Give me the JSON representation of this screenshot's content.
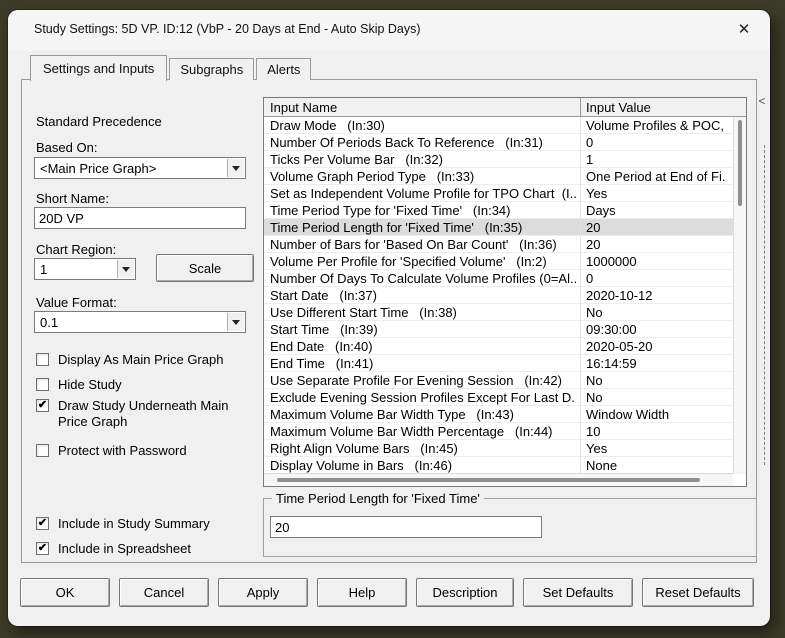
{
  "window": {
    "title": "Study Settings: 5D VP. ID:12 (VbP - 20 Days at End - Auto Skip Days)",
    "close_icon": "✕"
  },
  "tabs": [
    {
      "label": "Settings and Inputs",
      "active": true
    },
    {
      "label": "Subgraphs",
      "active": false
    },
    {
      "label": "Alerts",
      "active": false
    }
  ],
  "left_panel": {
    "precedence_label": "Standard Precedence",
    "based_on": {
      "label": "Based On:",
      "value": "<Main Price Graph>"
    },
    "short_name": {
      "label": "Short Name:",
      "value": "20D VP"
    },
    "chart_region": {
      "label": "Chart Region:",
      "value": "1"
    },
    "scale_button": "Scale",
    "value_format": {
      "label": "Value Format:",
      "value": "0.1"
    },
    "checkboxes": [
      {
        "label": "Display As Main Price Graph",
        "checked": false
      },
      {
        "label": "Hide Study",
        "checked": false
      },
      {
        "label": "Draw Study Underneath Main Price Graph",
        "checked": true
      },
      {
        "label": "Protect with Password",
        "checked": false
      }
    ],
    "bottom_checkboxes": [
      {
        "label": "Include in Study Summary",
        "checked": true
      },
      {
        "label": "Include in Spreadsheet",
        "checked": true
      }
    ]
  },
  "inputs_table": {
    "columns": [
      "Input Name",
      "Input Value"
    ],
    "selected_index": 6,
    "rows": [
      {
        "name": "Draw Mode   (In:30)",
        "value": "Volume Profiles & POC,"
      },
      {
        "name": "Number Of Periods Back To Reference   (In:31)",
        "value": "0"
      },
      {
        "name": "Ticks Per Volume Bar   (In:32)",
        "value": "1"
      },
      {
        "name": "Volume Graph Period Type   (In:33)",
        "value": "One Period at End of Fi."
      },
      {
        "name": "Set as Independent Volume Profile for TPO Chart  (I...",
        "value": "Yes"
      },
      {
        "name": "Time Period Type for 'Fixed Time'   (In:34)",
        "value": "Days"
      },
      {
        "name": "Time Period Length for 'Fixed Time'   (In:35)",
        "value": "20"
      },
      {
        "name": "Number of Bars for 'Based On Bar Count'   (In:36)",
        "value": "20"
      },
      {
        "name": "Volume Per Profile for 'Specified Volume'   (In:2)",
        "value": "1000000"
      },
      {
        "name": "Number Of Days To Calculate Volume Profiles (0=Al...",
        "value": "0"
      },
      {
        "name": "Start Date   (In:37)",
        "value": "2020-10-12"
      },
      {
        "name": "Use Different Start Time   (In:38)",
        "value": "No"
      },
      {
        "name": "Start Time   (In:39)",
        "value": "09:30:00"
      },
      {
        "name": "End Date   (In:40)",
        "value": "2020-05-20"
      },
      {
        "name": "End Time   (In:41)",
        "value": "16:14:59"
      },
      {
        "name": "Use Separate Profile For Evening Session   (In:42)",
        "value": "No"
      },
      {
        "name": "Exclude Evening Session Profiles Except For Last D...",
        "value": "No"
      },
      {
        "name": "Maximum Volume Bar Width Type   (In:43)",
        "value": "Window Width"
      },
      {
        "name": "Maximum Volume Bar Width Percentage   (In:44)",
        "value": "10"
      },
      {
        "name": "Right Align Volume Bars   (In:45)",
        "value": "Yes"
      },
      {
        "name": "Display Volume in Bars   (In:46)",
        "value": "None"
      }
    ]
  },
  "edit_group": {
    "label": "Time Period Length for 'Fixed Time'",
    "value": "20"
  },
  "right_strip": {
    "collapse_icon": "<"
  },
  "buttons": [
    "OK",
    "Cancel",
    "Apply",
    "Help",
    "Description",
    "Set Defaults",
    "Reset Defaults"
  ],
  "colors": {
    "desktop_bg": "#3b3b27",
    "dialog_bg": "#f0f0f0",
    "titlebar_bg": "#f5f5f5",
    "selected_row_bg": "#dcdcdc",
    "table_border": "#7a7a7a"
  }
}
